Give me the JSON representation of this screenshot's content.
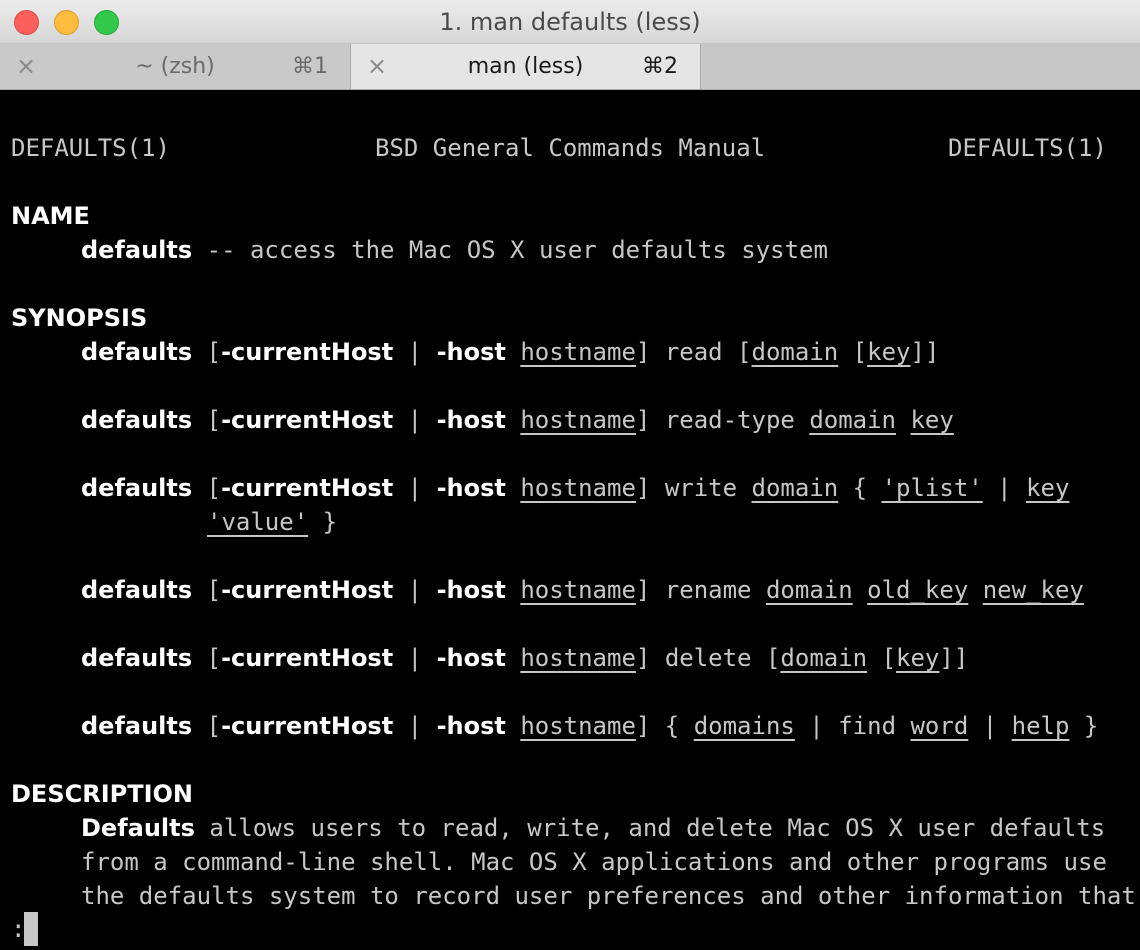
{
  "window": {
    "title": "1. man defaults (less)"
  },
  "tabs": [
    {
      "label": "~ (zsh)",
      "shortcut": "⌘1",
      "close": "×"
    },
    {
      "label": "man (less)",
      "shortcut": "⌘2",
      "close": "×"
    }
  ],
  "man": {
    "header_left": "DEFAULTS(1)",
    "header_center": "BSD General Commands Manual",
    "header_right": "DEFAULTS(1)",
    "name_heading": "NAME",
    "name_cmd": "defaults",
    "name_desc": " -- access the Mac OS X user defaults system",
    "synopsis_heading": "SYNOPSIS",
    "cmd": "defaults",
    "opt_current": "-currentHost",
    "opt_host": "-host",
    "arg_hostname": "hostname",
    "op_read": "read",
    "op_read_type": "read-type",
    "op_write": "write",
    "op_rename": "rename",
    "op_delete": "delete",
    "op_domains": "domains",
    "op_find": "find",
    "op_help": "help",
    "arg_domain": "domain",
    "arg_key": "key",
    "arg_plist": "'plist'",
    "arg_value": "'value'",
    "arg_word": "word",
    "arg_old_key": "old_key",
    "arg_new_key": "new_key",
    "description_heading": "DESCRIPTION",
    "desc_bold": "Defaults",
    "desc_line1_rest": " allows users to read, write, and delete Mac OS X user defaults",
    "desc_line2": "from a command-line shell. Mac OS X applications and other programs use",
    "desc_line3": "the defaults system to record user preferences and other information that",
    "prompt": ":"
  }
}
